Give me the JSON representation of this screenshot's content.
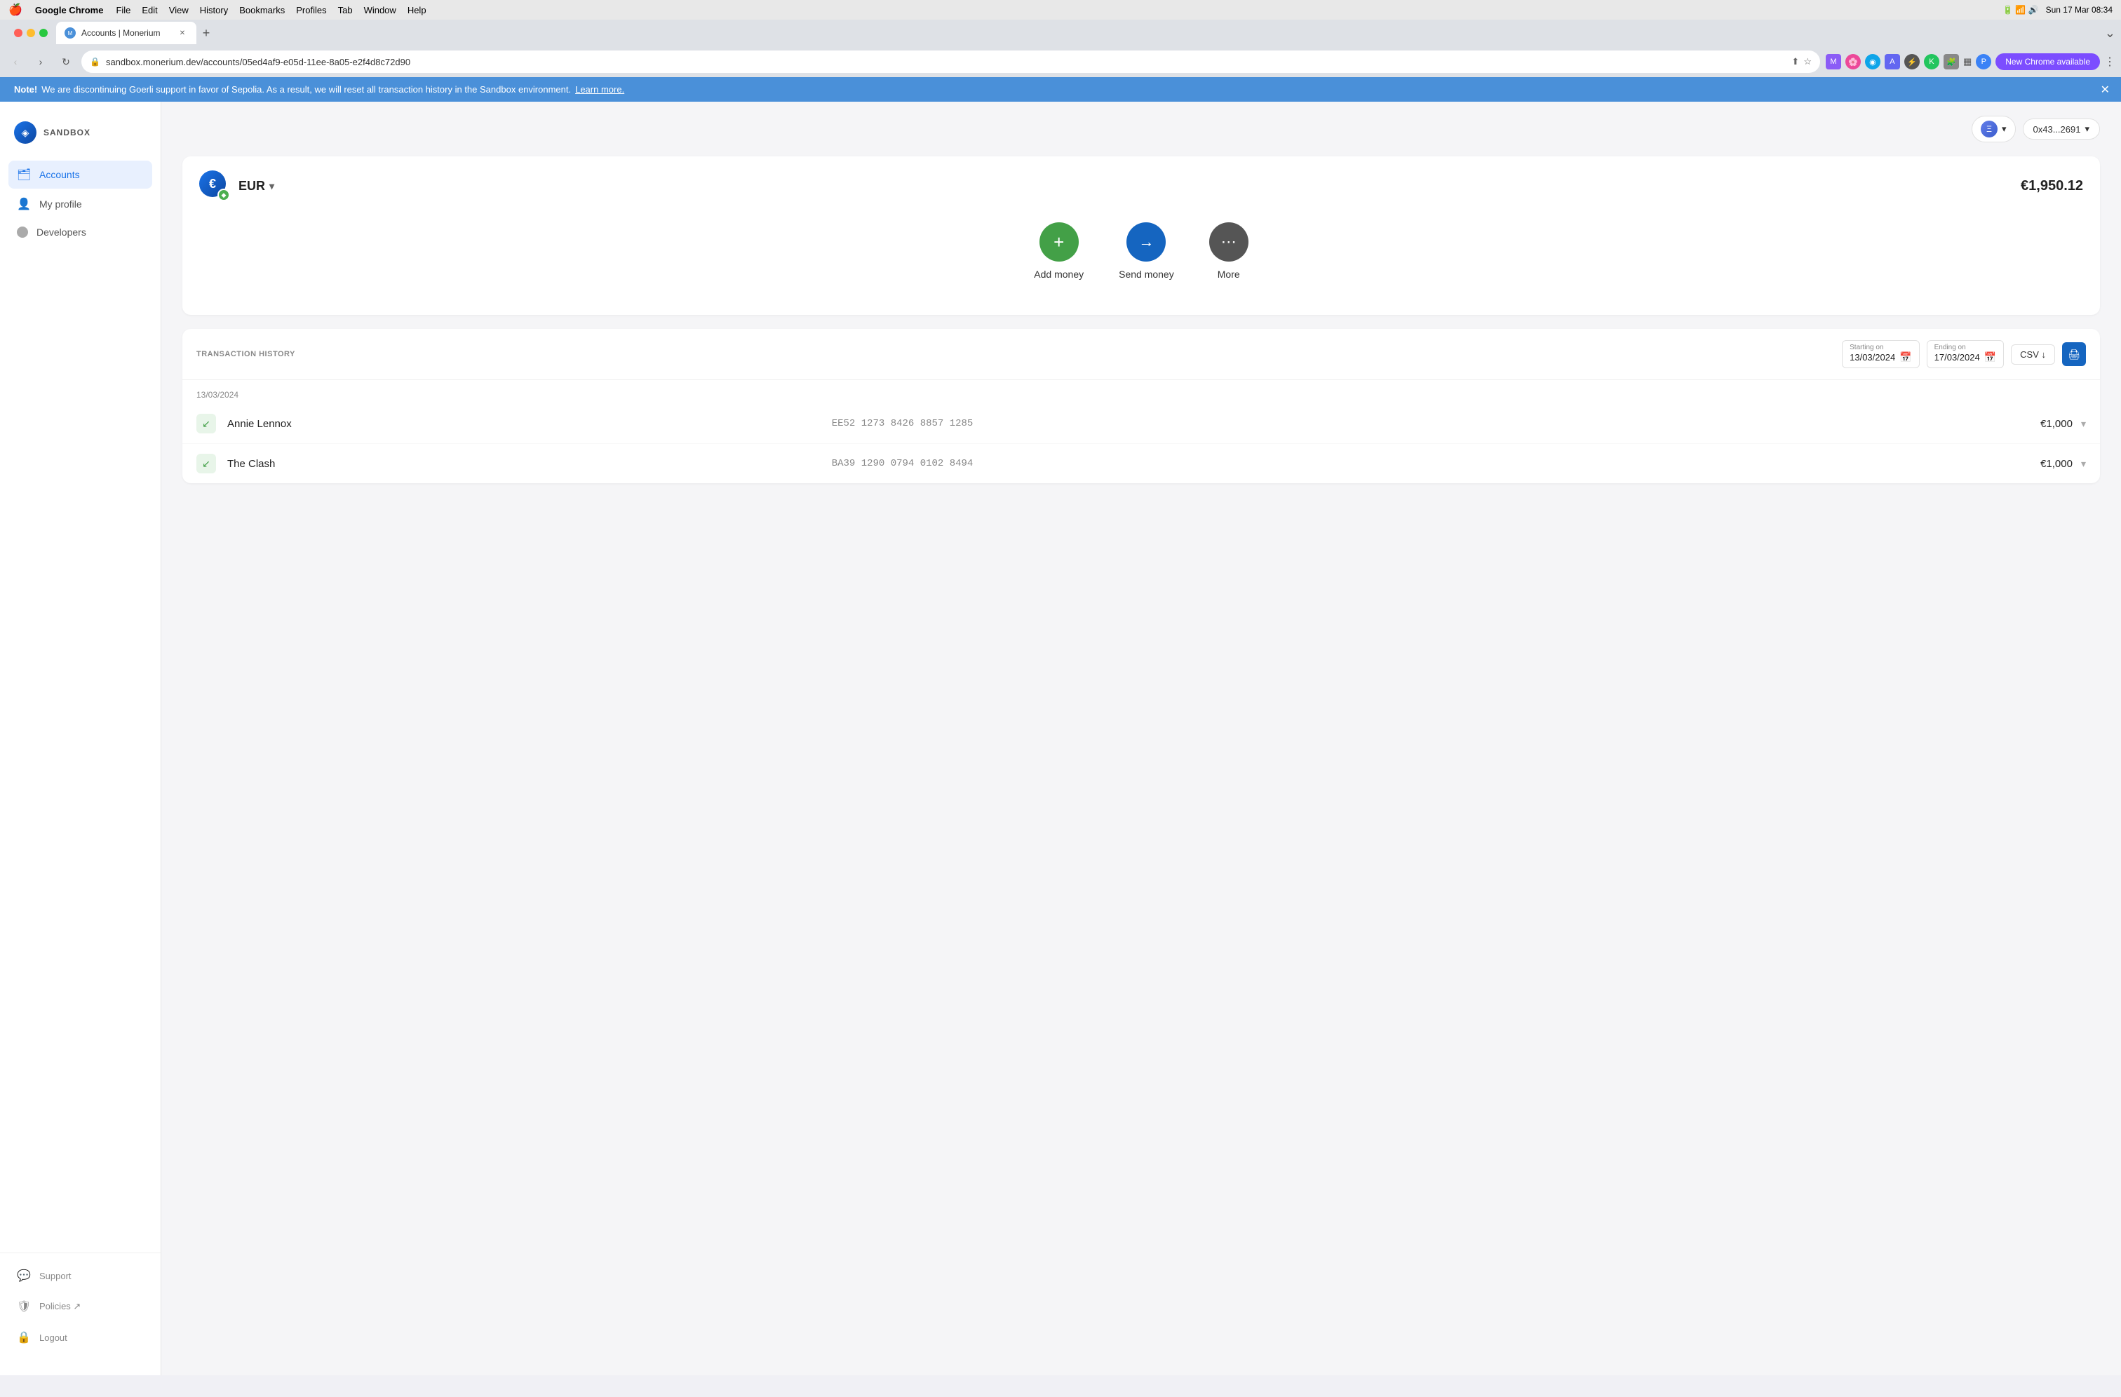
{
  "menubar": {
    "apple": "🍎",
    "app_name": "Google Chrome",
    "menus": [
      "File",
      "Edit",
      "View",
      "History",
      "Bookmarks",
      "Profiles",
      "Tab",
      "Window",
      "Help"
    ],
    "time": "Sun 17 Mar  08:34"
  },
  "browser": {
    "tab_title": "Accounts | Monerium",
    "tab_favicon": "M",
    "address": "sandbox.monerium.dev/accounts/05ed4af9-e05d-11ee-8a05-e2f4d8c72d90",
    "new_chrome_label": "New Chrome available"
  },
  "banner": {
    "note_label": "Note!",
    "message": " We are discontinuing Goerli support in favor of Sepolia. As a result, we will reset all transaction history in the Sandbox environment.",
    "link_text": "Learn more."
  },
  "sidebar": {
    "brand": "SANDBOX",
    "items": [
      {
        "id": "accounts",
        "label": "Accounts",
        "icon": "🗂"
      },
      {
        "id": "my-profile",
        "label": "My profile",
        "icon": "👤"
      },
      {
        "id": "developers",
        "label": "Developers",
        "icon": "⬛"
      }
    ],
    "bottom_items": [
      {
        "id": "support",
        "label": "Support",
        "icon": "💬"
      },
      {
        "id": "policies",
        "label": "Policies ↗",
        "icon": "🛡"
      },
      {
        "id": "logout",
        "label": "Logout",
        "icon": "🔒"
      }
    ]
  },
  "content": {
    "eth_selector_label": "Ξ",
    "wallet_label": "0x43...2691",
    "wallet_chevron": "▾",
    "currency": {
      "code": "EUR",
      "chevron": "▾",
      "balance": "€1,950.12"
    },
    "actions": [
      {
        "id": "add-money",
        "label": "Add money",
        "icon": "+",
        "color": "green"
      },
      {
        "id": "send-money",
        "label": "Send money",
        "icon": "→",
        "color": "blue"
      },
      {
        "id": "more",
        "label": "More",
        "icon": "⋯",
        "color": "gray"
      }
    ],
    "transaction_history": {
      "title": "TRANSACTION HISTORY",
      "starting_on_label": "Starting on",
      "starting_on_value": "13/03/2024",
      "ending_on_label": "Ending on",
      "ending_on_value": "17/03/2024",
      "csv_label": "CSV ↓",
      "date_group": "13/03/2024",
      "transactions": [
        {
          "name": "Annie Lennox",
          "reference": "EE52 1273 8426 8857 1285",
          "amount": "€1,000",
          "icon": "↙",
          "direction": "incoming"
        },
        {
          "name": "The Clash",
          "reference": "BA39 1290 0794 0102 8494",
          "amount": "€1,000",
          "icon": "↙",
          "direction": "incoming"
        }
      ]
    }
  }
}
